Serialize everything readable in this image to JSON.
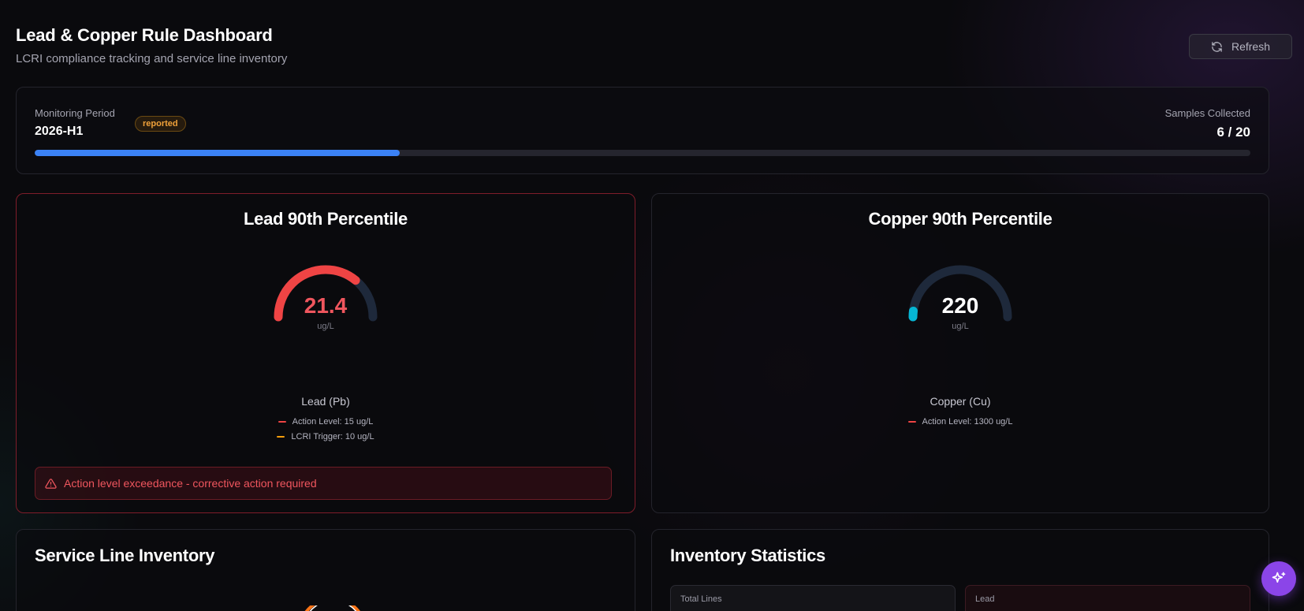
{
  "header": {
    "title": "Lead & Copper Rule Dashboard",
    "subtitle": "LCRI compliance tracking and service line inventory",
    "refresh_label": "Refresh"
  },
  "monitoring": {
    "period_label": "Monitoring Period",
    "period": "2026-H1",
    "status": "reported",
    "samples_label": "Samples Collected",
    "samples_text": "6 / 20",
    "samples_collected": 6,
    "samples_required": 20,
    "progress_fraction": 0.3
  },
  "lead": {
    "title": "Lead 90th Percentile",
    "value": "21.4",
    "unit": "ug/L",
    "metal": "Lead (Pb)",
    "gauge_fraction": 0.72,
    "legend": [
      {
        "label": "Action Level: 15 ug/L",
        "color": "#ef4444"
      },
      {
        "label": "LCRI Trigger: 10 ug/L",
        "color": "#f59e0b"
      }
    ],
    "alert": "Action level exceedance - corrective action required"
  },
  "copper": {
    "title": "Copper 90th Percentile",
    "value": "220",
    "unit": "ug/L",
    "metal": "Copper (Cu)",
    "gauge_fraction": 0.04,
    "legend": [
      {
        "label": "Action Level: 1300 ug/L",
        "color": "#ef4444"
      }
    ]
  },
  "inventory": {
    "title": "Service Line Inventory"
  },
  "stats": {
    "title": "Inventory Statistics",
    "total_label": "Total Lines",
    "total_value": "",
    "lead_label": "Lead",
    "lead_value": ""
  },
  "colors": {
    "accent": "#3b82f6",
    "danger": "#ef4444",
    "warning": "#f59e0b",
    "copper_gauge": "#06b6d4",
    "gauge_track": "#1e293b",
    "ai_button": "#8b45e8"
  },
  "icons": [
    "refresh-icon",
    "warning-triangle-icon",
    "sparkles-icon"
  ]
}
